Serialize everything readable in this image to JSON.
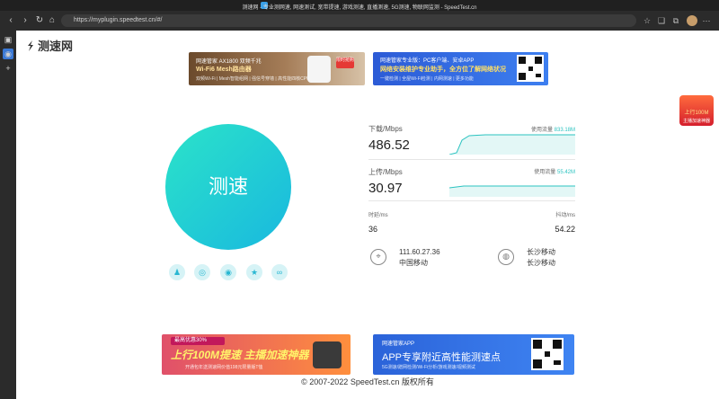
{
  "browser": {
    "window_title": "测速网 - 专业测网速, 网速测试, 宽带提速, 游戏测速, 直播测速, 5G测速, 物联网监测 - SpeedTest.cn",
    "url": "https://myplugin.speedtest.cn/#/",
    "icons": [
      "back-icon",
      "forward-icon",
      "reload-icon",
      "home-icon",
      "favorites-icon",
      "collections-icon",
      "extensions-icon",
      "profile-avatar",
      "more-icon"
    ]
  },
  "site": {
    "logo_text": "测速网",
    "footer": "© 2007-2022 SpeedTest.cn 版权所有"
  },
  "ads": {
    "top_left": {
      "line1": "网速管家 AX1800 双频千兆",
      "line2": "Wi-Fi6 Mesh路由器",
      "line3": "双频Wi-Fi | Mesh智能组网 | 强信号穿墙 | 高性能四核CPU",
      "badge": "限时抢购"
    },
    "top_right": {
      "line1": "网速管家专业版：PC客户端、安卓APP",
      "line2": "网络安装维护专业助手，全方位了解网络状况",
      "line3": "一键检测 | 全屋Wi-Fi检测 | 内网测速 | 更多功能"
    },
    "bottom_left": {
      "ribbon": "最高优惠30%",
      "line1": "上行100M提速 主播加速神器",
      "line2": "开通包年送测速网价值198元限量版T恤"
    },
    "bottom_right": {
      "line1": "网速管家APP",
      "line2": "APP专享附近高性能测速点",
      "line3": "5G测速/蹭网检测/Wi-Fi分析/游戏测速/视频测试"
    },
    "gift": {
      "line1": "上行100M",
      "line2": "主播加速神器"
    }
  },
  "speedtest": {
    "button_label": "测速",
    "download": {
      "label": "下载/Mbps",
      "value": "486.52",
      "usage_label": "使用流量",
      "usage_value": "833.18M"
    },
    "upload": {
      "label": "上传/Mbps",
      "value": "30.97",
      "usage_label": "使用流量",
      "usage_value": "55.42M"
    },
    "latency": {
      "label": "时延/ms",
      "value": "36"
    },
    "jitter": {
      "label": "抖动/ms",
      "value": "54.22"
    },
    "ip": {
      "address": "111.60.27.36",
      "isp": "中国移动"
    },
    "server": {
      "city": "长沙移动",
      "isp": "长沙移动"
    }
  },
  "share_icons": [
    "qq-icon",
    "wechat-icon",
    "weibo-icon",
    "favorite-star-icon",
    "link-icon"
  ],
  "colors": {
    "accent": "#2bc3c0",
    "circle_start": "#2be3c9",
    "circle_end": "#19b8df"
  }
}
